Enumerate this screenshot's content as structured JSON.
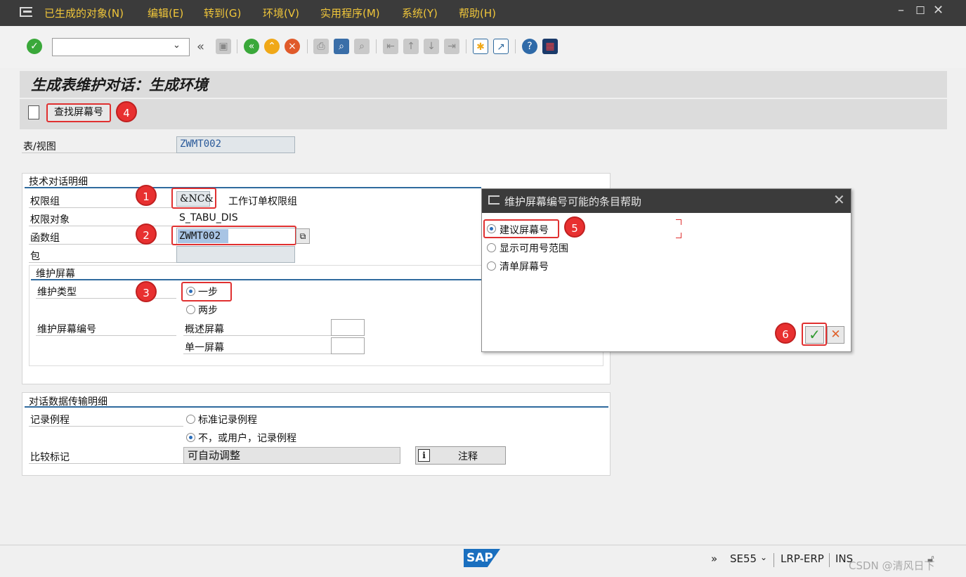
{
  "menu": {
    "items": [
      "已生成的对象(N)",
      "编辑(E)",
      "转到(G)",
      "环境(V)",
      "实用程序(M)",
      "系统(Y)",
      "帮助(H)"
    ]
  },
  "toolbar": {
    "command_field_value": "",
    "icons": [
      "enter-icon",
      "back-icon",
      "save-icon",
      "back-green-icon",
      "exit-icon",
      "cancel-icon",
      "print-icon",
      "find-icon",
      "find-next-icon",
      "first-page-icon",
      "prev-page-icon",
      "next-page-icon",
      "last-page-icon",
      "new-session-icon",
      "shortcut-icon",
      "help-icon",
      "customize-layout-icon"
    ]
  },
  "title": "生成表维护对话：生成环境",
  "app_toolbar": {
    "find_screen_label": "查找屏幕号"
  },
  "badges": {
    "b1": "1",
    "b2": "2",
    "b3": "3",
    "b4": "4",
    "b5": "5",
    "b6": "6"
  },
  "table_view": {
    "label": "表/视图",
    "value": "ZWMT002"
  },
  "tech_section": {
    "title": "技术对话明细",
    "auth_group_label": "权限组",
    "auth_group_value": "&NC&",
    "auth_group_desc": "工作订单权限组",
    "auth_object_label": "权限对象",
    "auth_object_value": "S_TABU_DIS",
    "function_group_label": "函数组",
    "function_group_value": "ZWMT002",
    "package_label": "包",
    "package_value": ""
  },
  "maint_screen": {
    "title": "维护屏幕",
    "type_label": "维护类型",
    "one_step": "一步",
    "two_step": "两步",
    "screen_no_label": "维护屏幕编号",
    "overview_label": "概述屏幕",
    "single_label": "单一屏幕",
    "overview_value": "",
    "single_value": ""
  },
  "transport_section": {
    "title": "对话数据传输明细",
    "record_label": "记录例程",
    "standard_option": "标准记录例程",
    "no_option": "不，或用户，记录例程",
    "compare_label": "比较标记",
    "compare_value": "可自动调整",
    "note_button": "注释"
  },
  "dialog": {
    "title": "维护屏幕编号可能的条目帮助",
    "options": [
      "建议屏幕号",
      "显示可用号范围",
      "清单屏幕号"
    ],
    "selected": 0
  },
  "status": {
    "chevron": "»",
    "transaction": "SE55",
    "system": "LRP-ERP",
    "mode": "INS",
    "logo": "SAP",
    "watermark": "CSDN @清风日下"
  }
}
